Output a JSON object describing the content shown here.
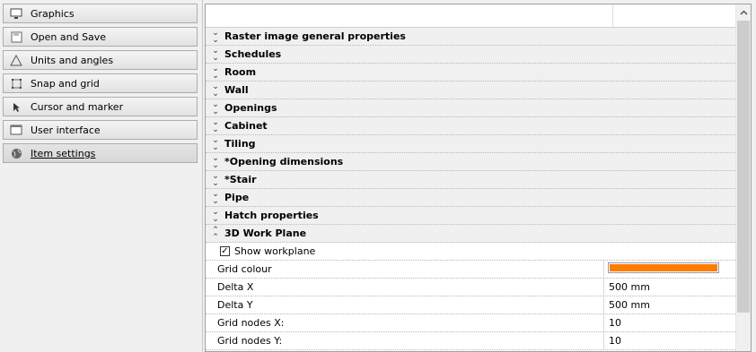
{
  "sidebar": {
    "items": [
      {
        "label": "Graphics",
        "icon": "monitor-icon"
      },
      {
        "label": "Open and Save",
        "icon": "floppy-disk-icon"
      },
      {
        "label": "Units and angles",
        "icon": "angle-icon"
      },
      {
        "label": "Snap and grid",
        "icon": "snap-grid-icon"
      },
      {
        "label": "Cursor and marker",
        "icon": "cursor-icon"
      },
      {
        "label": "User interface",
        "icon": "window-icon"
      },
      {
        "label": "Item settings",
        "icon": "globe-icon",
        "selected": true
      }
    ]
  },
  "panel": {
    "categories": [
      {
        "label": "Raster image general properties"
      },
      {
        "label": "Schedules"
      },
      {
        "label": "Room"
      },
      {
        "label": "Wall"
      },
      {
        "label": "Openings"
      },
      {
        "label": "Cabinet"
      },
      {
        "label": "Tiling"
      },
      {
        "label": "*Opening dimensions"
      },
      {
        "label": "*Stair"
      },
      {
        "label": "Pipe"
      },
      {
        "label": "Hatch properties"
      },
      {
        "label": "3D Work Plane",
        "expanded": true
      }
    ],
    "workplane": {
      "show_label": "Show workplane",
      "show_checked": true,
      "properties": [
        {
          "name": "Grid colour",
          "value": "",
          "color": "#ff7c00"
        },
        {
          "name": "Delta X",
          "value": "500 mm"
        },
        {
          "name": "Delta Y",
          "value": "500 mm"
        },
        {
          "name": "Grid nodes X:",
          "value": "10"
        },
        {
          "name": "Grid nodes Y:",
          "value": "10"
        }
      ]
    }
  },
  "colors": {
    "grid_colour": "#ff7c00"
  }
}
